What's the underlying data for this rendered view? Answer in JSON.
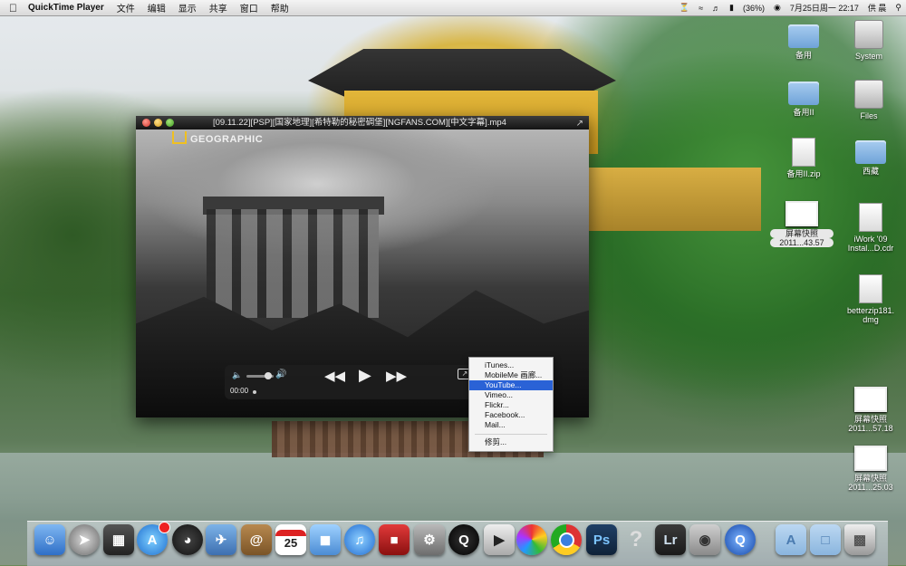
{
  "menubar": {
    "app_name": "QuickTime Player",
    "menus": [
      "文件",
      "编辑",
      "显示",
      "共享",
      "窗口",
      "帮助"
    ],
    "battery": "(36%)",
    "datetime": "7月25日周一 22:17",
    "user": "供 晨"
  },
  "window": {
    "title": "[09.11.22][PSP][国家地理][希特勒的秘密碉堡][NGFANS.COM][中文字幕].mp4",
    "watermark": "GEOGRAPHIC",
    "time": "00:00"
  },
  "share_menu": {
    "items": [
      "iTunes...",
      "MobileMe 画廊...",
      "YouTube...",
      "Vimeo...",
      "Flickr...",
      "Facebook...",
      "Mail...",
      "修剪..."
    ],
    "selected": "YouTube..."
  },
  "desktop_icons": [
    {
      "label": "备用",
      "kind": "folder"
    },
    {
      "label": "System",
      "kind": "drive"
    },
    {
      "label": "备用II",
      "kind": "folder"
    },
    {
      "label": "Files",
      "kind": "drive"
    },
    {
      "label": "备用II.zip",
      "kind": "zip"
    },
    {
      "label": "西藏",
      "kind": "folder"
    },
    {
      "label": "屏幕快照",
      "sublabel": "2011...43.57",
      "kind": "screenshot"
    },
    {
      "label": "iWork '09",
      "sublabel": "Instal...D.cdr",
      "kind": "disk-image"
    },
    {
      "label": "betterzip181.",
      "sublabel": "dmg",
      "kind": "disk-image"
    },
    {
      "label": "屏幕快照",
      "sublabel": "2011...57.18",
      "kind": "screenshot"
    },
    {
      "label": "屏幕快照",
      "sublabel": "2011...25.03",
      "kind": "screenshot"
    }
  ],
  "dock": {
    "calendar_day": "25",
    "apps": [
      "finder-icon",
      "launchpad-icon",
      "photo-booth-icon",
      "app-store-icon",
      "dashboard-icon",
      "preview-icon",
      "address-book-icon",
      "ical-icon",
      "iphoto-icon",
      "itunes-icon",
      "photo-app-icon",
      "system-preferences-icon",
      "qq-icon",
      "dvd-player-icon",
      "picasa-icon",
      "chrome-icon",
      "photoshop-icon",
      "unknown-app-icon",
      "lightroom-icon",
      "facetime-icon",
      "quicktime-icon",
      "applications-folder-icon",
      "documents-folder-icon",
      "trash-icon"
    ],
    "ps_label": "Ps",
    "lr_label": "Lr",
    "unknown_label": "?"
  },
  "colors": {
    "menu_highlight": "#2a62d6",
    "badge_red": "#e22222"
  }
}
